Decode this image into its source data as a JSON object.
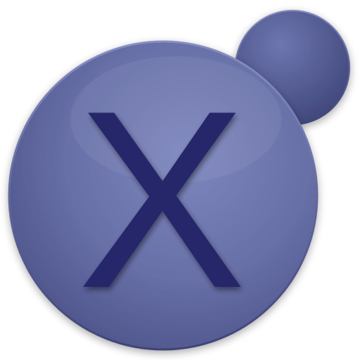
{
  "icon": {
    "name": "x-app-icon",
    "glyph": "X",
    "colors": {
      "disc_light": "#7d86bd",
      "disc_mid": "#6870a8",
      "disc_dark": "#4b5288",
      "small_disc_light": "#6d76b0",
      "small_disc_dark": "#3f4679",
      "glyph_fill": "#26286a",
      "glyph_shadow": "#1b1c4f",
      "rim": "#3c4275",
      "background": "#ffffff"
    }
  }
}
